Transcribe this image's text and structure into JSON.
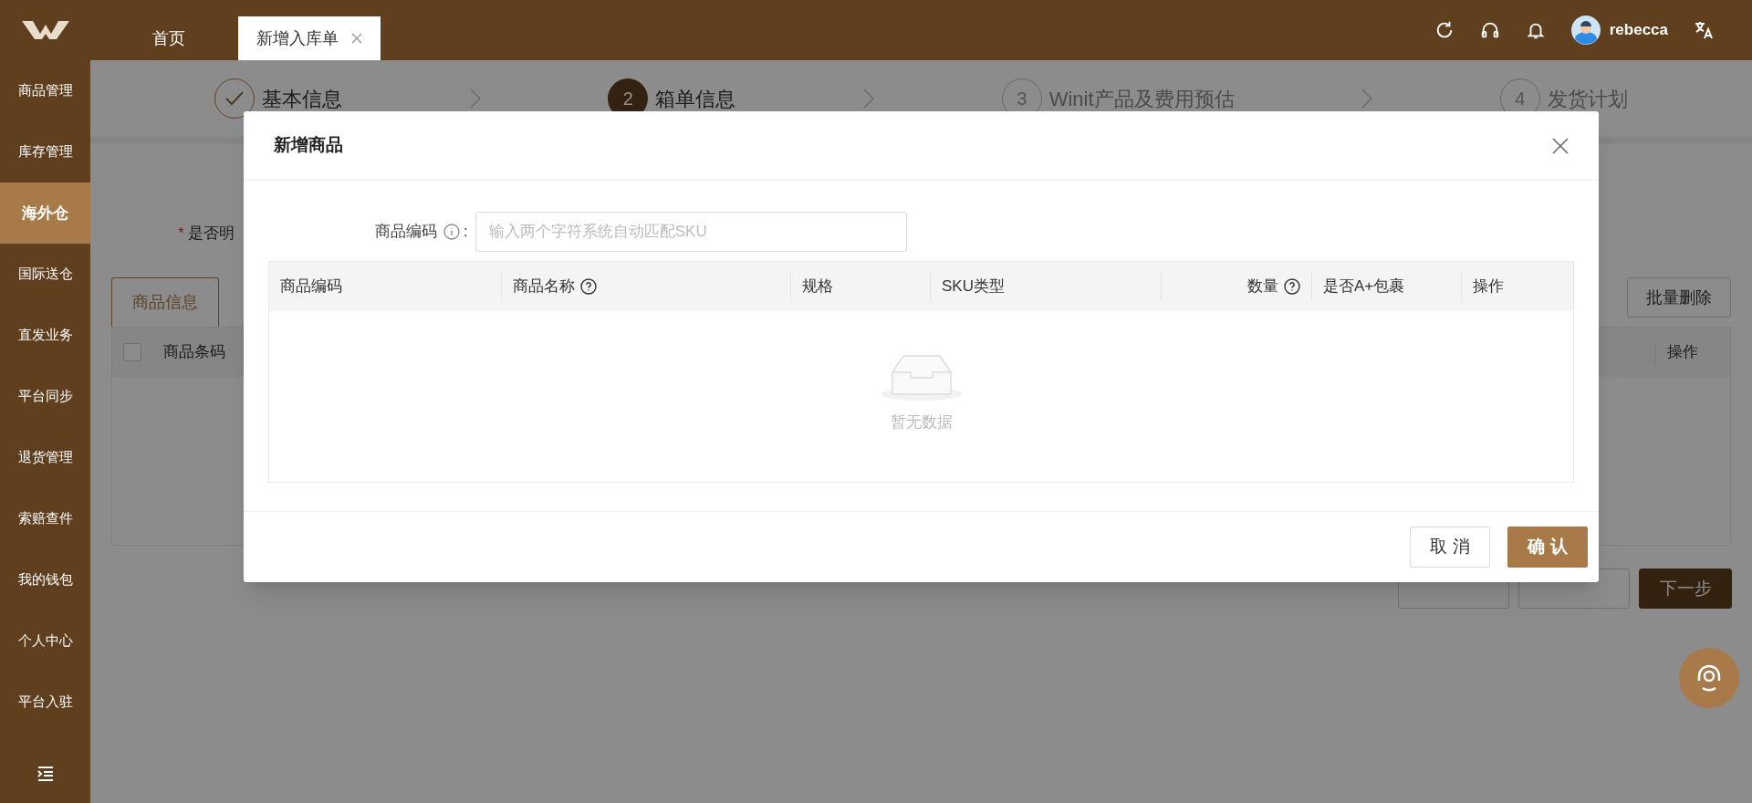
{
  "top_bar": {
    "tabs": [
      {
        "label": "首页",
        "selected": false,
        "closable": false
      },
      {
        "label": "新增入库单",
        "selected": true,
        "closable": true
      }
    ],
    "user": {
      "name": "rebecca"
    }
  },
  "sidebar": {
    "items": [
      {
        "label": "商品管理",
        "selected": false
      },
      {
        "label": "库存管理",
        "selected": false
      },
      {
        "label": "海外仓",
        "selected": true
      },
      {
        "label": "国际送仓",
        "selected": false
      },
      {
        "label": "直发业务",
        "selected": false
      },
      {
        "label": "平台同步",
        "selected": false
      },
      {
        "label": "退货管理",
        "selected": false
      },
      {
        "label": "索赔查件",
        "selected": false
      },
      {
        "label": "我的钱包",
        "selected": false
      },
      {
        "label": "个人中心",
        "selected": false
      },
      {
        "label": "平台入驻",
        "selected": false
      }
    ]
  },
  "steps": [
    {
      "label": "基本信息",
      "completed": true,
      "active": false
    },
    {
      "number": "2",
      "label": "箱单信息",
      "completed": false,
      "active": true
    },
    {
      "number": "3",
      "label": "Winit产品及费用预估",
      "completed": false,
      "active": false
    },
    {
      "number": "4",
      "label": "发货计划",
      "completed": false,
      "active": false
    }
  ],
  "form": {
    "required_mark": "*",
    "label": "是否明"
  },
  "content_tabs": [
    {
      "label": "商品信息",
      "selected": true
    }
  ],
  "toolbar_buttons": [
    "批量删除"
  ],
  "table": {
    "select_all_checked": false,
    "columns": [
      "商品条码",
      "操作"
    ]
  },
  "footer_buttons": [
    {
      "kind": "default"
    },
    {
      "kind": "default"
    },
    {
      "label": "下一步",
      "kind": "primary"
    }
  ],
  "modal": {
    "title": "新增商品",
    "field": {
      "label": "商品编码",
      "separator": ":",
      "placeholder": "输入两个字符系统自动匹配SKU"
    },
    "table": {
      "columns": [
        {
          "label": "商品编码",
          "help": false
        },
        {
          "label": "商品名称",
          "help": true
        },
        {
          "label": "规格",
          "help": false
        },
        {
          "label": "SKU类型",
          "help": false
        },
        {
          "label": "数量",
          "help": true
        },
        {
          "label": "是否A+包裹",
          "help": false
        },
        {
          "label": "操作",
          "help": false
        }
      ],
      "empty_text": "暂无数据"
    },
    "buttons": [
      {
        "label": "取 消",
        "kind": "default"
      },
      {
        "label": "确 认",
        "kind": "primary"
      }
    ]
  }
}
